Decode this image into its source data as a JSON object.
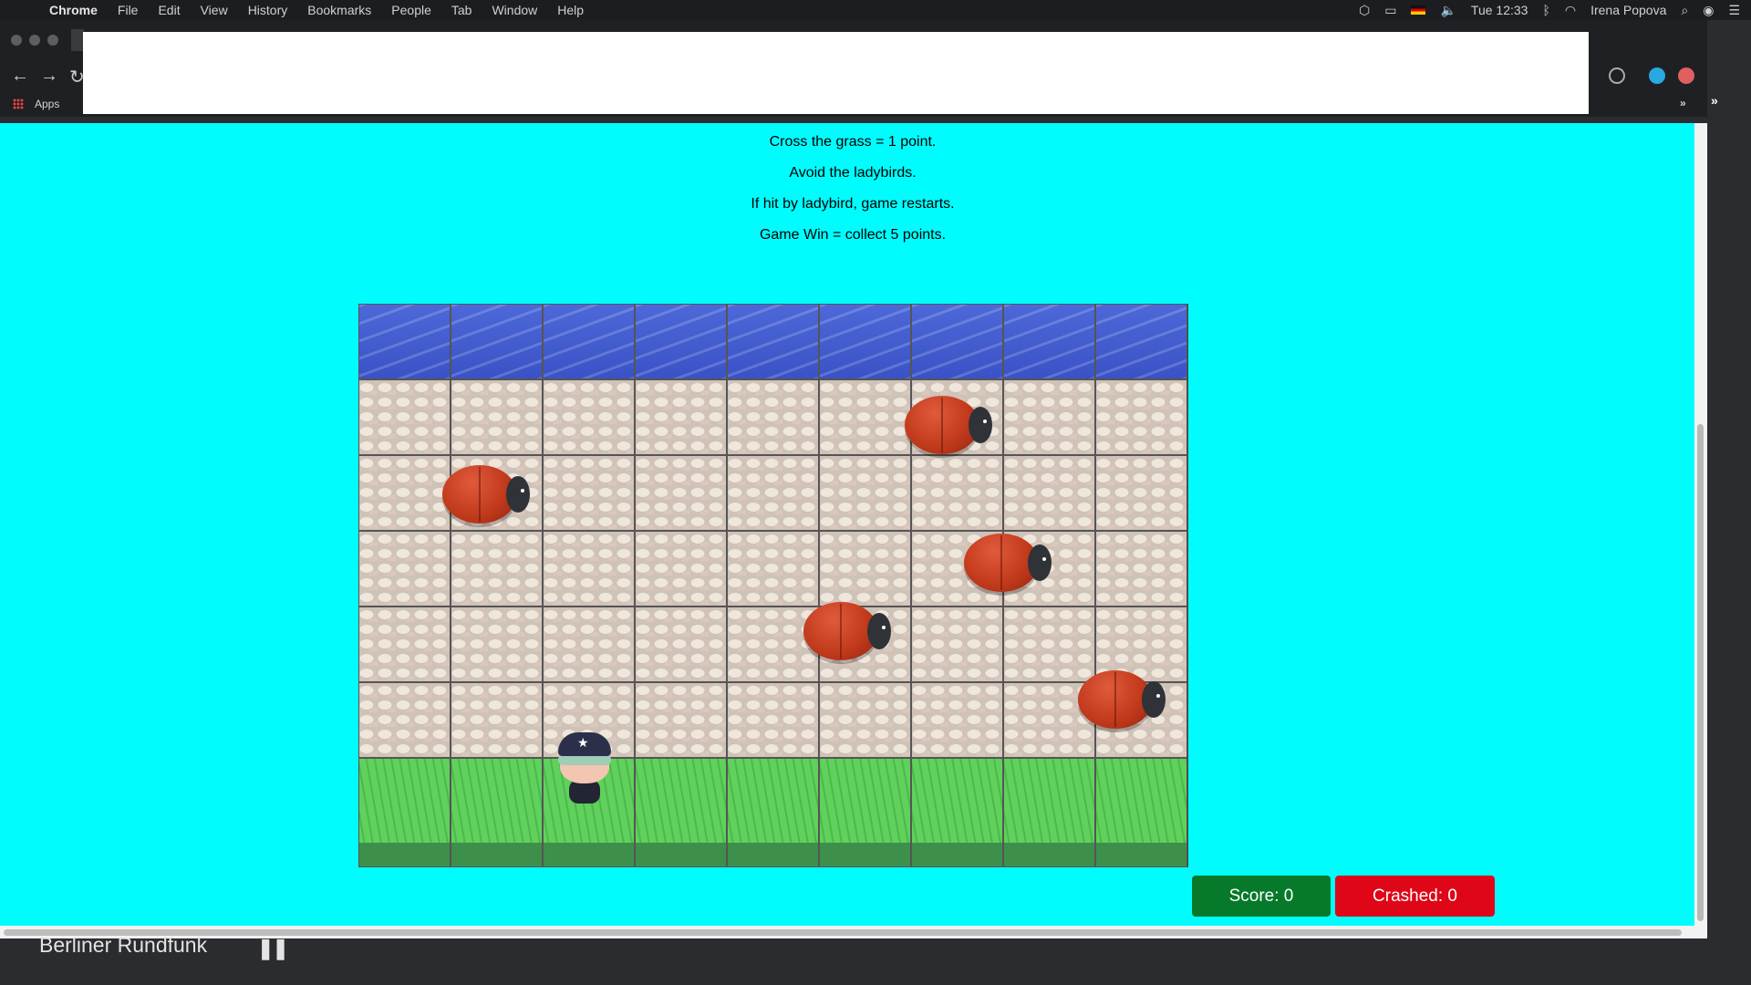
{
  "menubar": {
    "app_name": "Chrome",
    "menus": [
      "File",
      "Edit",
      "View",
      "History",
      "Bookmarks",
      "People",
      "Tab",
      "Window",
      "Help"
    ],
    "clock": "Tue 12:33",
    "user": "Irena Popova"
  },
  "bookmarks": {
    "apps_label": "Apps",
    "overflow": "»"
  },
  "instructions": [
    "Cross the grass = 1 point.",
    "Avoid the ladybirds.",
    "If hit by ladybird, game restarts.",
    "Game Win = collect 5 points."
  ],
  "scoreboard": {
    "score_label": "Score: 0",
    "crashed_label": "Crashed: 0"
  },
  "bottom_bar": {
    "station": "Berliner Rundfunk",
    "pause_icon": "❚❚"
  },
  "colors": {
    "page_bg": "#00fdfe",
    "score_bg": "#067a2a",
    "crashed_bg": "#df0618"
  }
}
